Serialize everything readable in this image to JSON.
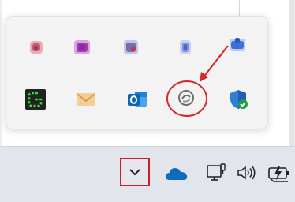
{
  "flyout": {
    "rows": [
      [
        {
          "icon": "blurred-app-icon"
        },
        {
          "icon": "blurred-app-icon"
        },
        {
          "icon": "blurred-app-icon"
        },
        {
          "icon": "blurred-app-icon"
        },
        {
          "icon": "blurred-app-icon"
        }
      ],
      [
        {
          "icon": "greenshot-icon"
        },
        {
          "icon": "mail-icon"
        },
        {
          "icon": "outlook-icon"
        },
        {
          "icon": "copilot-icon",
          "highlighted": true
        },
        {
          "icon": "windows-security-icon"
        }
      ]
    ]
  },
  "annotation": {
    "color": "#d42a2a",
    "target": "copilot-icon"
  },
  "taskbar": {
    "items": [
      {
        "icon": "chevron-up-icon",
        "role": "show-hidden-icons",
        "highlighted": true
      },
      {
        "icon": "onedrive-icon"
      },
      {
        "icon": "network-icon"
      },
      {
        "icon": "volume-icon"
      },
      {
        "icon": "battery-icon"
      }
    ]
  },
  "colors": {
    "accent_red": "#c8202a",
    "taskbar_bg": "#e3e5ec",
    "flyout_bg": "#f3f3f3",
    "onedrive_blue": "#0f6cbd",
    "outlook_blue": "#0a64b8",
    "greenshot_green": "#3adb34",
    "mail_gold": "#e8b56a",
    "security_blue": "#2f7fd8",
    "security_check_green": "#1e9e45"
  }
}
